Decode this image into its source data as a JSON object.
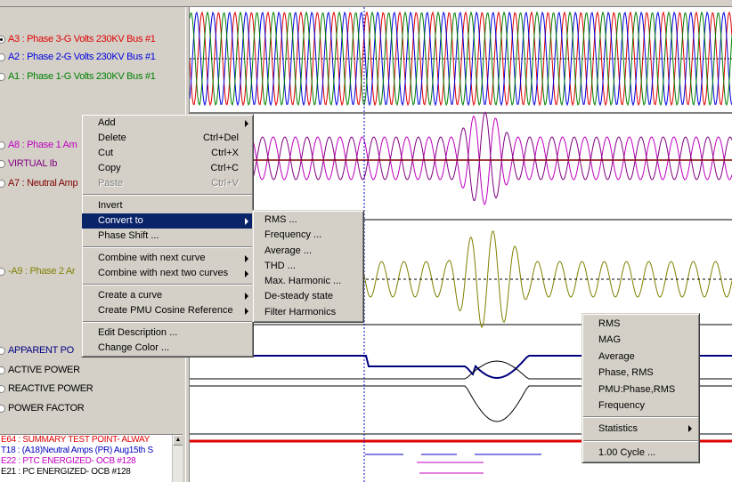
{
  "channels": [
    {
      "label": "A3 : Phase 3-G Volts 230KV Bus #1",
      "color": "#e00000",
      "selected": true
    },
    {
      "label": "A2 : Phase 2-G Volts 230KV Bus #1",
      "color": "#0000e0",
      "selected": false
    },
    {
      "label": "A1 : Phase 1-G Volts 230KV Bus #1",
      "color": "#008000",
      "selected": false
    },
    {
      "label": "A8 : Phase 1 Am",
      "color": "#c000c0",
      "selected": false
    },
    {
      "label": "VIRTUAL Ib",
      "color": "#800080",
      "selected": false
    },
    {
      "label": "A7 : Neutral Amp",
      "color": "#800000",
      "selected": false
    },
    {
      "label": "-A9 : Phase 2 Ar",
      "color": "#808000",
      "selected": false
    },
    {
      "label": "APPARENT PO",
      "color": "#000080",
      "selected": false
    },
    {
      "label": "ACTIVE POWER",
      "color": "#000000",
      "selected": false
    },
    {
      "label": "REACTIVE POWER",
      "color": "#000000",
      "selected": false
    },
    {
      "label": "POWER FACTOR",
      "color": "#000000",
      "selected": false
    }
  ],
  "events": [
    {
      "text": "E64 : SUMMARY TEST POINT- ALWAY",
      "color": "#e00000"
    },
    {
      "text": "T18 : (A18)Neutral Amps (PR) Aug15th S",
      "color": "#0000c0"
    },
    {
      "text": "E22 : PTC ENERGIZED- OCB #128",
      "color": "#c000c0"
    },
    {
      "text": "E21 : PC ENERGIZED- OCB #128",
      "color": "#000000"
    }
  ],
  "context_menu": [
    {
      "label": "Add",
      "shortcut": "",
      "submenu": true
    },
    {
      "label": "Delete",
      "shortcut": "Ctrl+Del"
    },
    {
      "label": "Cut",
      "shortcut": "Ctrl+X"
    },
    {
      "label": "Copy",
      "shortcut": "Ctrl+C"
    },
    {
      "label": "Paste",
      "shortcut": "Ctrl+V",
      "disabled": true
    },
    {
      "separator": true
    },
    {
      "label": "Invert",
      "shortcut": ""
    },
    {
      "label": "Convert to",
      "shortcut": "",
      "submenu": true,
      "highlighted": true
    },
    {
      "label": "Phase Shift ...",
      "shortcut": ""
    },
    {
      "separator": true
    },
    {
      "label": "Combine with next curve",
      "shortcut": "",
      "submenu": true
    },
    {
      "label": "Combine with next two curves",
      "shortcut": "",
      "submenu": true
    },
    {
      "separator": true
    },
    {
      "label": "Create a curve",
      "shortcut": "",
      "submenu": true
    },
    {
      "label": "Create PMU Cosine Reference",
      "shortcut": "",
      "submenu": true
    },
    {
      "separator": true
    },
    {
      "label": "Edit Description ...",
      "shortcut": ""
    },
    {
      "label": "Change Color ...",
      "shortcut": ""
    }
  ],
  "convert_submenu": [
    "RMS ...",
    "Frequency ...",
    "Average ...",
    "THD ...",
    "Max. Harmonic ...",
    "De-steady state",
    "Filter Harmonics"
  ],
  "measure_menu": {
    "items": [
      "RMS",
      "MAG",
      "Average",
      "Phase, RMS",
      "PMU:Phase,RMS",
      "Frequency"
    ],
    "statistics_label": "Statistics",
    "cycle_label": "1.00 Cycle ..."
  },
  "icons": {
    "radio": "radio-button",
    "submenu": "submenu-arrow-icon",
    "scroll_up": "scroll-up-icon"
  }
}
